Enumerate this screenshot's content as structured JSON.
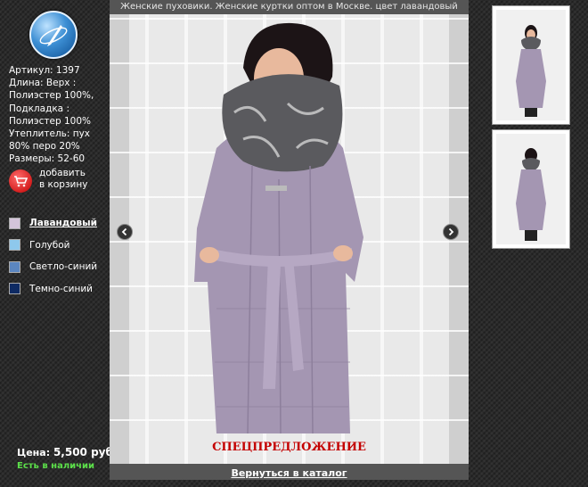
{
  "header": {
    "title": "Женские пуховики. Женские куртки оптом в Москве. цвет лавандовый"
  },
  "logo": {
    "icon": "pen-globe-logo-icon"
  },
  "specs": [
    "Артикул: 1397",
    "Длина: Верх :",
    "Полиэстер 100%,",
    "Подкладка :",
    "Полиэстер 100%",
    "Утеплитель: пух",
    "80% перо 20%",
    "Размеры: 52-60"
  ],
  "cart": {
    "line1": "добавить",
    "line2": "в корзину",
    "icon": "shopping-cart-icon"
  },
  "colors": [
    {
      "label": "Лавандовый",
      "hex": "#d4c4da",
      "active": true
    },
    {
      "label": "Голубой",
      "hex": "#8ec8ec",
      "active": false
    },
    {
      "label": "Светло-синий",
      "hex": "#5b86c0",
      "active": false
    },
    {
      "label": "Темно-синий",
      "hex": "#0e2a63",
      "active": false
    }
  ],
  "price": {
    "label": "Цена:",
    "value": "5,500 руб."
  },
  "stock": "Есть в наличии",
  "special": "СПЕЦПРЕДЛОЖЕНИЕ",
  "back_link": "Вернуться в каталог",
  "nav": {
    "prev_icon": "arrow-left-icon",
    "next_icon": "arrow-right-icon"
  },
  "theme": {
    "coat": "#a496b2",
    "fur": "#5a5a5e",
    "accent_red": "#c40000",
    "stock_green": "#5ce04a"
  }
}
